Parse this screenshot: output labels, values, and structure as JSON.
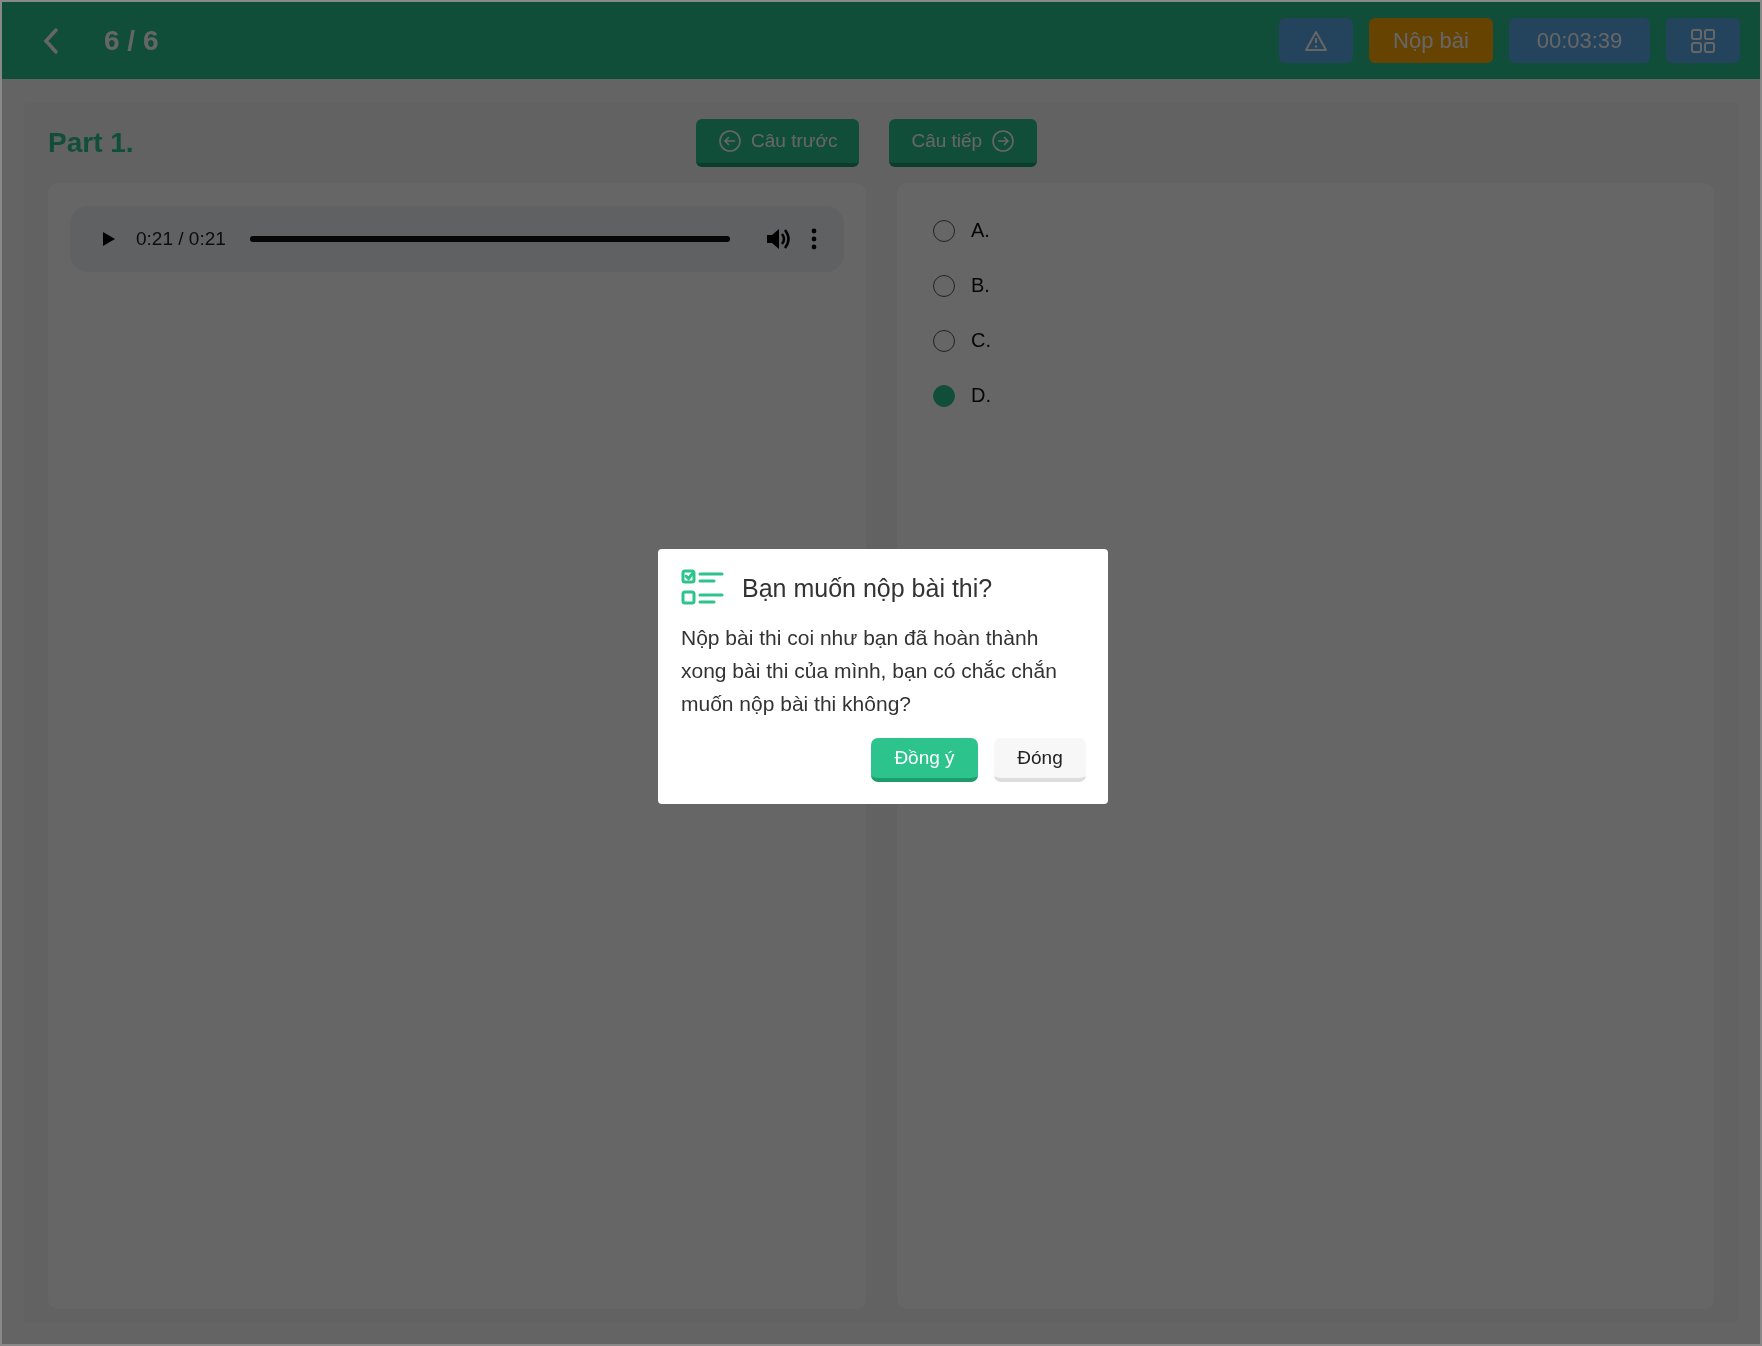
{
  "header": {
    "counter": "6 / 6",
    "submit_label": "Nộp bài",
    "timer": "00:03:39"
  },
  "part": {
    "title": "Part 1.",
    "prev_label": "Câu trước",
    "next_label": "Câu tiếp"
  },
  "audio": {
    "time": "0:21 / 0:21",
    "level": 1
  },
  "options": [
    {
      "label": "A.",
      "selected": false
    },
    {
      "label": "B.",
      "selected": false
    },
    {
      "label": "C.",
      "selected": false
    },
    {
      "label": "D.",
      "selected": true
    }
  ],
  "dialog": {
    "title": "Bạn muốn nộp bài thi?",
    "message": "Nộp bài thi coi như bạn đã hoàn thành xong bài thi của mình, bạn có chắc chắn muốn nộp bài thi không?",
    "buttons": [
      {
        "label": "Đồng ý",
        "kind": "primary"
      },
      {
        "label": "Đóng",
        "kind": "secondary"
      }
    ]
  }
}
